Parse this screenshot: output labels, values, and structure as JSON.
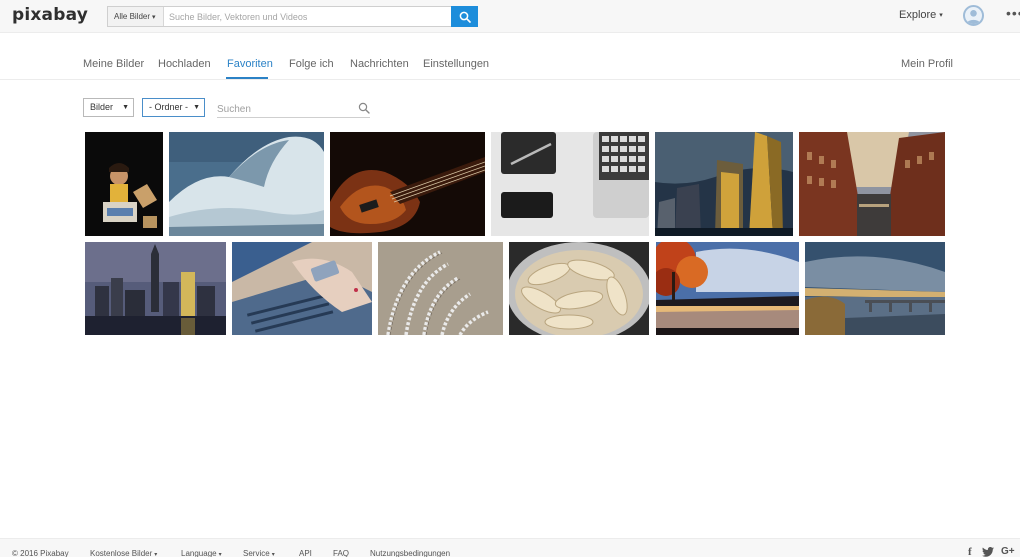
{
  "header": {
    "logo": "pixabay",
    "search": {
      "category": "Alle Bilder",
      "placeholder": "Suche Bilder, Vektoren und Videos",
      "value": ""
    },
    "explore_label": "Explore",
    "more_label": "•••"
  },
  "nav": {
    "items": [
      {
        "label": "Meine Bilder"
      },
      {
        "label": "Hochladen"
      },
      {
        "label": "Favoriten"
      },
      {
        "label": "Folge ich"
      },
      {
        "label": "Nachrichten"
      },
      {
        "label": "Einstellungen"
      }
    ],
    "active": "Favoriten",
    "profile": "Mein Profil"
  },
  "filters": {
    "type": "Bilder",
    "folder": "- Ordner -",
    "search_placeholder": "Suchen"
  },
  "footer": {
    "copyright": "© 2016 Pixabay",
    "links": [
      {
        "label": "Kostenlose Bilder",
        "dropdown": true
      },
      {
        "label": "Language",
        "dropdown": true
      },
      {
        "label": "Service",
        "dropdown": true
      },
      {
        "label": "API",
        "dropdown": false
      },
      {
        "label": "FAQ",
        "dropdown": false
      },
      {
        "label": "Nutzungsbedingungen",
        "dropdown": false
      }
    ],
    "social": [
      "f",
      "G+"
    ]
  },
  "colors": {
    "accent": "#1d8ddb",
    "active_tab": "#2b82c6"
  }
}
